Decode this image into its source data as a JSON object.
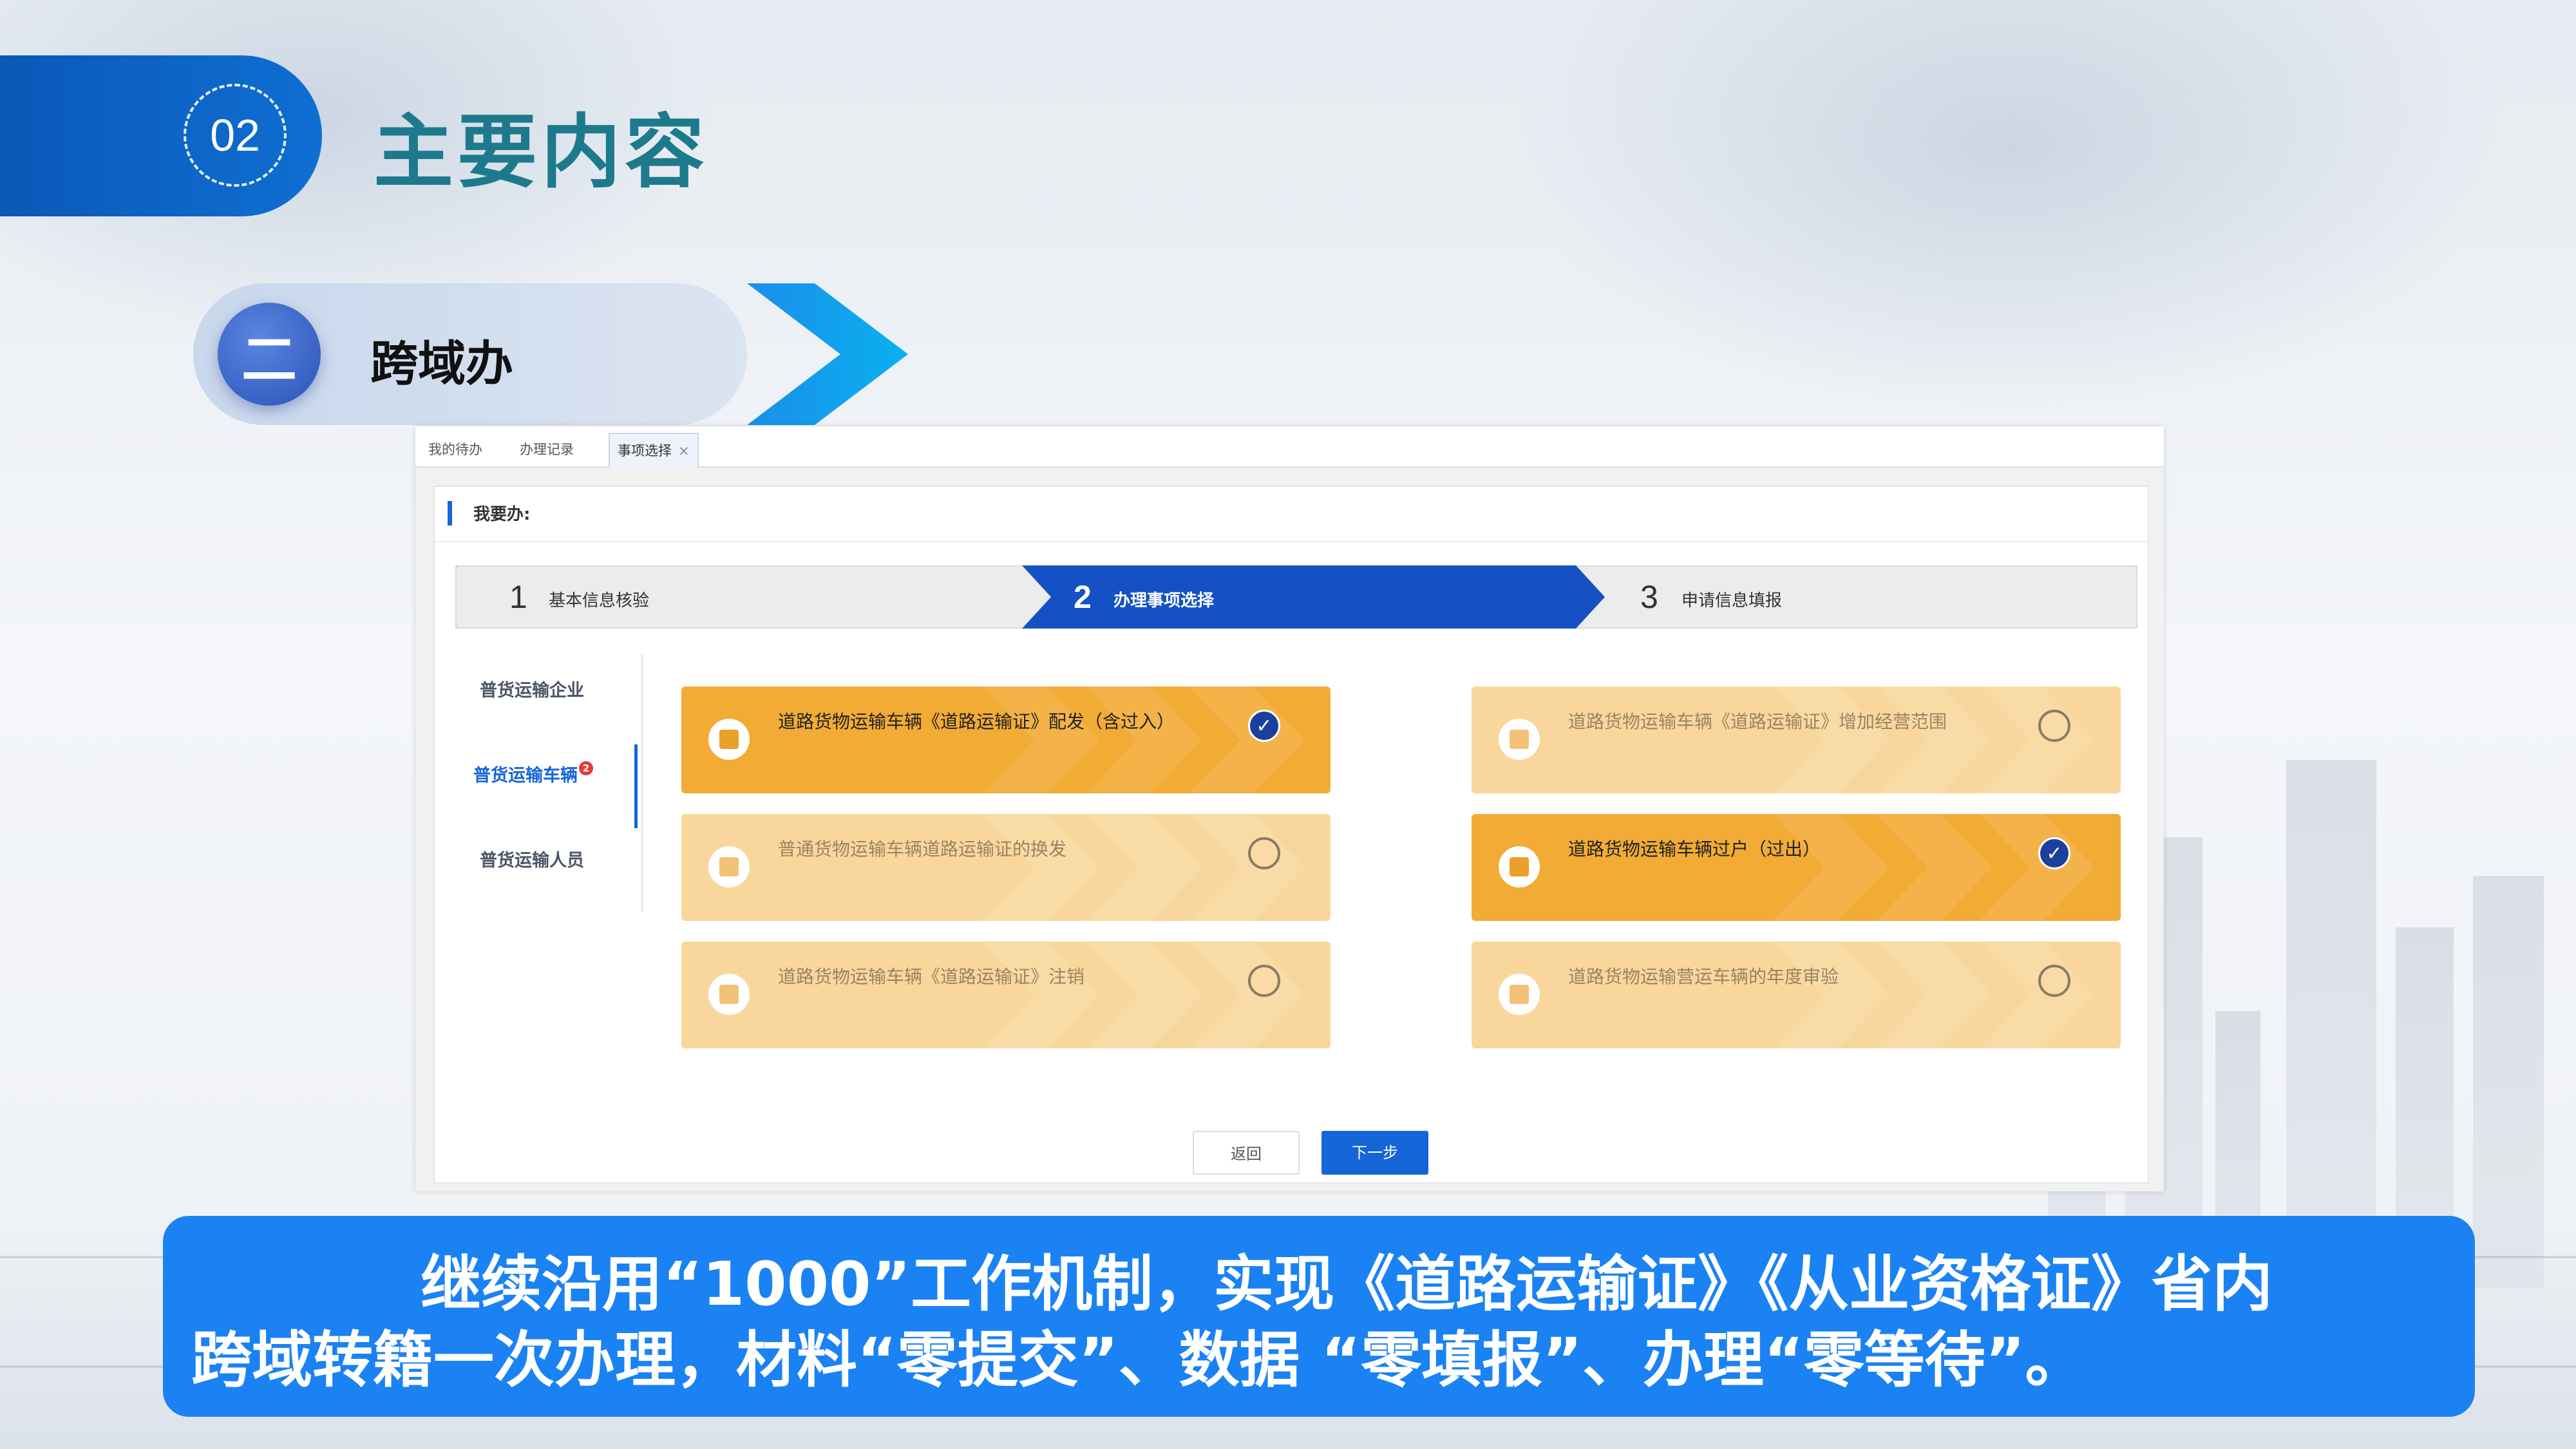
{
  "header": {
    "number": "02",
    "title": "主要内容"
  },
  "section": {
    "numeral": "二",
    "label": "跨域办"
  },
  "screenshot": {
    "tabs": [
      {
        "label": "我的待办"
      },
      {
        "label": "办理记录"
      },
      {
        "label": "事项选择",
        "close": "×"
      }
    ],
    "panel_title": "我要办:",
    "steps": [
      {
        "num": "1",
        "label": "基本信息核验"
      },
      {
        "num": "2",
        "label": "办理事项选择"
      },
      {
        "num": "3",
        "label": "申请信息填报"
      }
    ],
    "sidebar": [
      {
        "label": "普货运输企业"
      },
      {
        "label": "普货运输车辆",
        "badge": "2"
      },
      {
        "label": "普货运输人员"
      }
    ],
    "cards": [
      {
        "text": "道路货物运输车辆《道路运输证》配发（含过入）",
        "selected": true
      },
      {
        "text": "道路货物运输车辆《道路运输证》增加经营范围",
        "selected": false
      },
      {
        "text": "普通货物运输车辆道路运输证的换发",
        "selected": false
      },
      {
        "text": "道路货物运输车辆过户（过出）",
        "selected": true
      },
      {
        "text": "道路货物运输车辆《道路运输证》注销",
        "selected": false
      },
      {
        "text": "道路货物运输营运车辆的年度审验",
        "selected": false
      }
    ],
    "buttons": {
      "back": "返回",
      "next": "下一步"
    }
  },
  "caption": {
    "line1": "继续沿用“1000”工作机制，实现《道路运输证》《从业资格证》省内",
    "line2": "跨域转籍一次办理，材料“零提交”、数据 “零填报”、办理“零等待”。"
  },
  "colors": {
    "brand_blue": "#0f6fd2",
    "caption_blue": "#1a82f3",
    "card_selected": "#f2ab34",
    "card_unselected": "#f9d79c",
    "step_active": "#1551c4"
  },
  "icons": {
    "check": "check-icon",
    "radio": "radio-empty-icon",
    "card": "document-icon",
    "arrow": "chevron-right-icon"
  }
}
